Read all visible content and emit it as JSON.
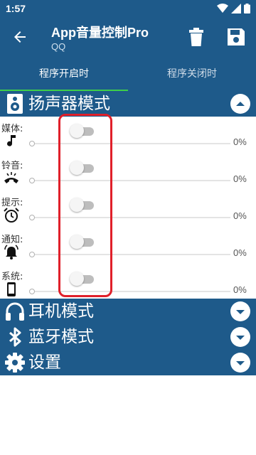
{
  "status_bar": {
    "time": "1:57"
  },
  "app_bar": {
    "title": "App音量控制Pro",
    "subtitle": "QQ"
  },
  "tabs": [
    {
      "label": "程序开启时",
      "active": true
    },
    {
      "label": "程序关闭时",
      "active": false
    }
  ],
  "sections": {
    "speaker": {
      "label": "扬声器模式",
      "expanded": true
    },
    "headphone": {
      "label": "耳机模式",
      "expanded": false
    },
    "bluetooth": {
      "label": "蓝牙模式",
      "expanded": false
    },
    "settings": {
      "label": "设置",
      "expanded": false
    }
  },
  "speaker_rows": [
    {
      "label": "媒体:",
      "icon": "music-note-icon",
      "switch_on": false,
      "volume_percent": "0%"
    },
    {
      "label": "铃音:",
      "icon": "ringing-phone-icon",
      "switch_on": false,
      "volume_percent": "0%"
    },
    {
      "label": "提示:",
      "icon": "alarm-clock-icon",
      "switch_on": false,
      "volume_percent": "0%"
    },
    {
      "label": "通知:",
      "icon": "notification-bell-icon",
      "switch_on": false,
      "volume_percent": "0%"
    },
    {
      "label": "系统:",
      "icon": "phone-device-icon",
      "switch_on": false,
      "volume_percent": "0%"
    }
  ],
  "colors": {
    "primary": "#1e5a8a",
    "tab_indicator": "#3ecf4a",
    "highlight_box": "#e0202a"
  }
}
